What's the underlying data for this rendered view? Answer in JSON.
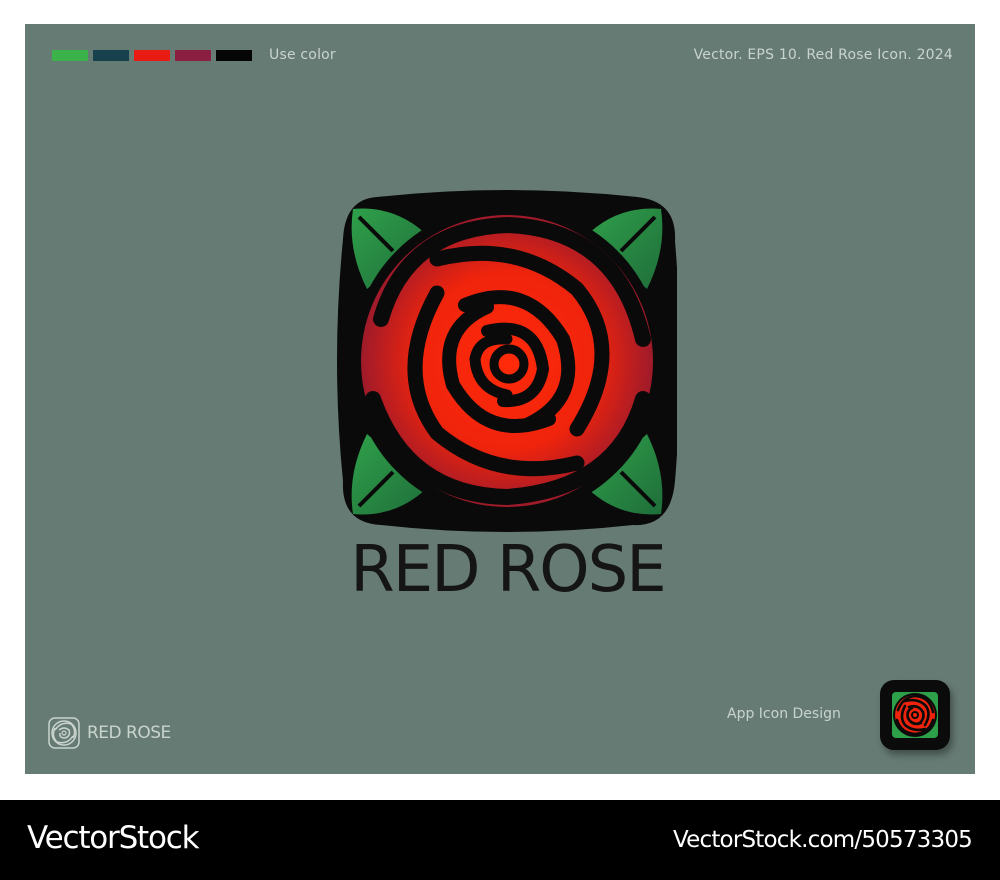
{
  "palette": {
    "label": "Use color",
    "colors": [
      "#3bb34a",
      "#17424d",
      "#e81c12",
      "#8a1f42",
      "#050505"
    ],
    "color_names": [
      "green-swatch",
      "dark-teal-swatch",
      "red-swatch",
      "wine-swatch",
      "black-swatch"
    ]
  },
  "header": {
    "note": "Vector. EPS 10. Red Rose Icon. 2024"
  },
  "logo": {
    "title": "RED ROSE",
    "background_color": "#667b73",
    "petal_color": "#ff2a0a",
    "leaf_color": "#2fa04a",
    "outline_color": "#0a0a0a"
  },
  "mini_logo": {
    "text": "RED ROSE"
  },
  "app_icon": {
    "label": "App Icon Design"
  },
  "footer": {
    "brand": "VectorStock",
    "url": "VectorStock.com/50573305"
  }
}
